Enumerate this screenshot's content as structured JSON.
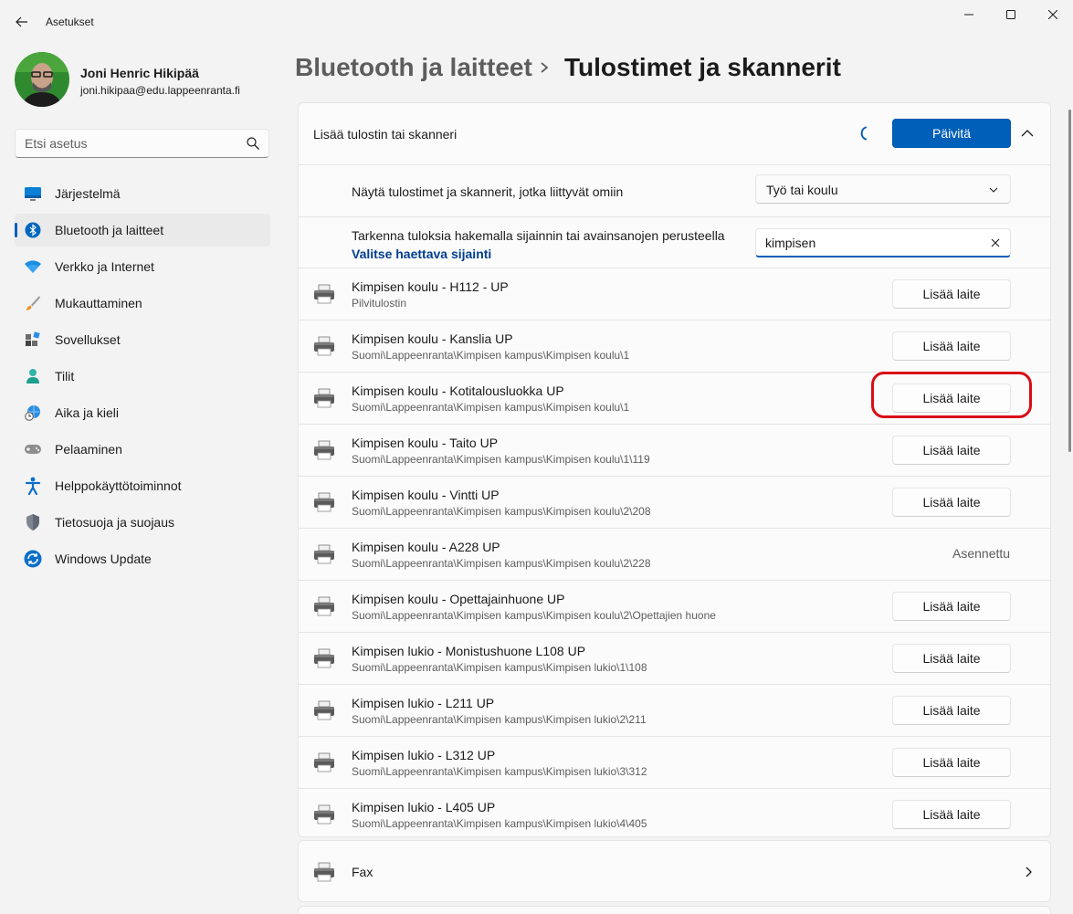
{
  "app": {
    "title": "Asetukset"
  },
  "user": {
    "name": "Joni Henric Hikipää",
    "email": "joni.hikipaa@edu.lappeenranta.fi"
  },
  "search": {
    "placeholder": "Etsi asetus"
  },
  "sidebar": {
    "items": [
      {
        "label": "Järjestelmä",
        "icon": "monitor-icon"
      },
      {
        "label": "Bluetooth ja laitteet",
        "icon": "bluetooth-icon",
        "active": true
      },
      {
        "label": "Verkko ja Internet",
        "icon": "wifi-icon"
      },
      {
        "label": "Mukauttaminen",
        "icon": "brush-icon"
      },
      {
        "label": "Sovellukset",
        "icon": "apps-icon"
      },
      {
        "label": "Tilit",
        "icon": "person-icon"
      },
      {
        "label": "Aika ja kieli",
        "icon": "globe-clock-icon"
      },
      {
        "label": "Pelaaminen",
        "icon": "gamepad-icon"
      },
      {
        "label": "Helppokäyttötoiminnot",
        "icon": "accessibility-icon"
      },
      {
        "label": "Tietosuoja ja suojaus",
        "icon": "shield-icon"
      },
      {
        "label": "Windows Update",
        "icon": "update-icon"
      }
    ]
  },
  "breadcrumb": {
    "parent": "Bluetooth ja laitteet",
    "current": "Tulostimet ja skannerit"
  },
  "add_section": {
    "title": "Lisää tulostin tai skanneri",
    "update_label": "Päivitä",
    "filter_label": "Näytä tulostimet ja skannerit, jotka liittyvät omiin",
    "filter_value": "Työ tai koulu",
    "refine_label": "Tarkenna tuloksia hakemalla sijainnin tai avainsanojen perusteella",
    "refine_link": "Valitse haettava sijainti",
    "location_value": "kimpisen"
  },
  "printers": [
    {
      "name": "Kimpisen koulu - H112 - UP",
      "path": "Pilvitulostin",
      "action": "Lisää laite"
    },
    {
      "name": "Kimpisen koulu - Kanslia UP",
      "path": "Suomi\\Lappeenranta\\Kimpisen kampus\\Kimpisen koulu\\1",
      "action": "Lisää laite"
    },
    {
      "name": "Kimpisen koulu - Kotitalousluokka UP",
      "path": "Suomi\\Lappeenranta\\Kimpisen kampus\\Kimpisen koulu\\1",
      "action": "Lisää laite"
    },
    {
      "name": "Kimpisen koulu - Taito UP",
      "path": "Suomi\\Lappeenranta\\Kimpisen kampus\\Kimpisen koulu\\1\\119",
      "action": "Lisää laite"
    },
    {
      "name": "Kimpisen koulu - Vintti UP",
      "path": "Suomi\\Lappeenranta\\Kimpisen kampus\\Kimpisen koulu\\2\\208",
      "action": "Lisää laite"
    },
    {
      "name": "Kimpisen koulu - A228 UP",
      "path": "Suomi\\Lappeenranta\\Kimpisen kampus\\Kimpisen koulu\\2\\228",
      "status": "Asennettu"
    },
    {
      "name": "Kimpisen koulu - Opettajainhuone UP",
      "path": "Suomi\\Lappeenranta\\Kimpisen kampus\\Kimpisen koulu\\2\\Opettajien huone",
      "action": "Lisää laite"
    },
    {
      "name": "Kimpisen lukio - Monistushuone L108 UP",
      "path": "Suomi\\Lappeenranta\\Kimpisen kampus\\Kimpisen lukio\\1\\108",
      "action": "Lisää laite"
    },
    {
      "name": "Kimpisen lukio - L211 UP",
      "path": "Suomi\\Lappeenranta\\Kimpisen kampus\\Kimpisen lukio\\2\\211",
      "action": "Lisää laite"
    },
    {
      "name": "Kimpisen lukio - L312 UP",
      "path": "Suomi\\Lappeenranta\\Kimpisen kampus\\Kimpisen lukio\\3\\312",
      "action": "Lisää laite"
    },
    {
      "name": "Kimpisen lukio - L405 UP",
      "path": "Suomi\\Lappeenranta\\Kimpisen kampus\\Kimpisen lukio\\4\\405",
      "action": "Lisää laite"
    }
  ],
  "fax": {
    "label": "Fax"
  },
  "colors": {
    "accent": "#005fb8",
    "highlight": "#d90d16",
    "link": "#003e92"
  }
}
